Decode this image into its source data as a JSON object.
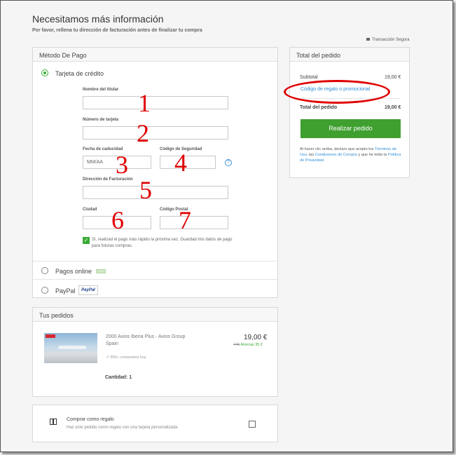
{
  "header": {
    "title": "Necesitamos más información",
    "subtitle": "Por favor, rellena tu dirección de facturación antes de finalizar tu compra",
    "secure": "Transacción Segura"
  },
  "payment": {
    "heading": "Método De Pago",
    "card_option": "Tarjeta de crédito",
    "fields": {
      "holder_label": "Nombre del titular",
      "number_label": "Número de tarjeta",
      "expiry_label": "Fecha de caducidad",
      "expiry_placeholder": "MM/AA",
      "cvv_label": "Código de Seguridad",
      "address_label": "Dirección de Facturación",
      "city_label": "Ciudad",
      "zip_label": "Código Postal"
    },
    "annotations": [
      "1",
      "2",
      "3",
      "4",
      "5",
      "6",
      "7"
    ],
    "help": "?",
    "save_note": "Sí, realizad el pago más rápido la próxima vez. Guardad mis datos de pago para futuras compras.",
    "online_option": "Pagos online",
    "paypal_option": "PayPal",
    "paypal_badge": "PayPal"
  },
  "summary": {
    "heading": "Total del pedido",
    "subtotal_label": "Subtotal",
    "subtotal_value": "19,00 €",
    "promo_link": "Código de regalo o promocional",
    "total_label": "Total del pedido",
    "total_value": "19,00 €",
    "order_button": "Realizar pedido",
    "legal_prefix": "Al hacer clic arriba, declaro que acepto los ",
    "legal_terms": "Términos de Uso",
    "legal_mid": ", las ",
    "legal_conditions": "Condiciones de Compra",
    "legal_mid2": " y que he leído la ",
    "legal_privacy": "Política de Privacidad",
    "legal_end": "."
  },
  "orders": {
    "heading": "Tus pedidos",
    "item_title": "2000 Avios Iberia Plus - Avios Group",
    "item_location": "Spain",
    "bought": "300+ comprados hoy",
    "price": "19,00 €",
    "old_price": "44€",
    "savings": "Ahorras 35 €",
    "quantity": "Cantidad: 1"
  },
  "gift": {
    "title": "Comprar como regalo",
    "subtitle": "Haz este pedido como regalo con una tarjeta personalizada"
  },
  "colors": {
    "accent_green": "#3f9f2f",
    "link_blue": "#2f8ed6",
    "annotation_red": "#e00000"
  }
}
